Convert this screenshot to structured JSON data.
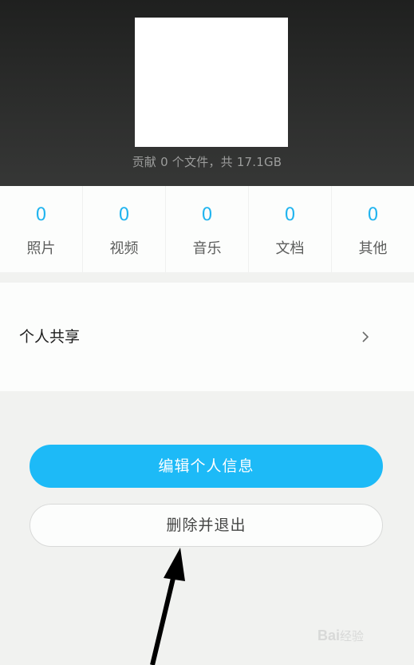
{
  "profile": {
    "contribution_text": "贡献 0 个文件，共 17.1GB"
  },
  "stats": [
    {
      "count": "0",
      "label": "照片"
    },
    {
      "count": "0",
      "label": "视频"
    },
    {
      "count": "0",
      "label": "音乐"
    },
    {
      "count": "0",
      "label": "文档"
    },
    {
      "count": "0",
      "label": "其他"
    }
  ],
  "share": {
    "label": "个人共享"
  },
  "buttons": {
    "edit_label": "编辑个人信息",
    "delete_label": "删除并退出"
  },
  "watermark": {
    "brand": "Bai",
    "suffix": "经验"
  },
  "colors": {
    "accent": "#1dbaf7",
    "count_color": "#21b4ef",
    "header_bg": "#2a2b2a",
    "page_bg": "#f1f2f0"
  },
  "icons": {
    "share_chevron": "chevron-right-icon",
    "annotation_arrow": "arrow-up-icon"
  }
}
